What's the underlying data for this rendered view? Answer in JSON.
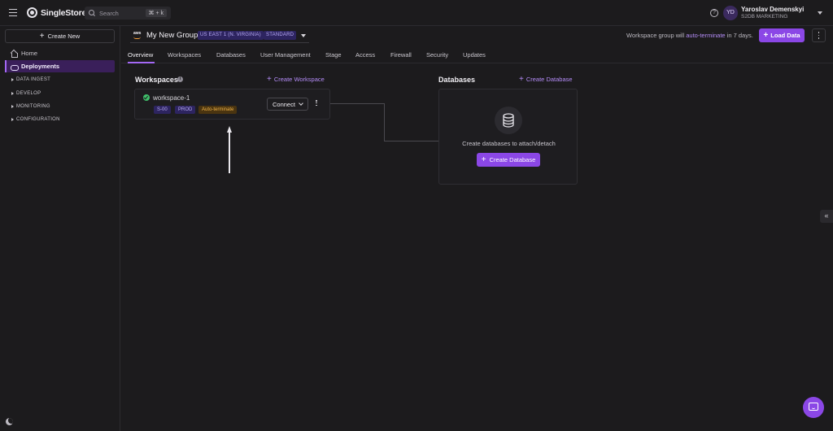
{
  "topbar": {
    "brand": "SingleStore",
    "search_placeholder": "Search",
    "search_shortcut": "⌘ + k",
    "help_icon": "?",
    "user": {
      "initials": "YD",
      "name": "Yaroslav Demenskyi",
      "org": "S2DB MARKETING"
    }
  },
  "sidebar": {
    "create_new": "Create New",
    "items": [
      {
        "label": "Home",
        "icon": "home-icon"
      },
      {
        "label": "Deployments",
        "icon": "cloud-icon",
        "active": true
      }
    ],
    "sections": [
      "DATA INGEST",
      "DEVELOP",
      "MONITORING",
      "CONFIGURATION"
    ]
  },
  "header": {
    "provider_icon": "aws",
    "group_name": "My New Group",
    "region": "US EAST 1 (N. VIRGINIA)",
    "edition": "STANDARD",
    "note_prefix": "Workspace group will ",
    "note_link": "auto-terminate",
    "note_suffix": " in 7 days.",
    "load_data": "Load Data"
  },
  "tabs": [
    "Overview",
    "Workspaces",
    "Databases",
    "User Management",
    "Stage",
    "Access",
    "Firewall",
    "Security",
    "Updates"
  ],
  "active_tab": "Overview",
  "workspaces": {
    "title": "Workspaces",
    "create_link": "Create Workspace",
    "items": [
      {
        "name": "workspace-1",
        "status": "running",
        "size": "S-00",
        "env": "PROD",
        "flag": "Auto-terminate",
        "connect": "Connect"
      }
    ]
  },
  "databases": {
    "title": "Databases",
    "create_link": "Create Database",
    "empty_text": "Create databases to attach/detach",
    "create_button": "Create Database"
  },
  "colors": {
    "accent": "#8b47e6",
    "accent_text": "#b48cf7",
    "background": "#1c1b1d",
    "success": "#3fbf6a",
    "warning": "#f1b448"
  }
}
